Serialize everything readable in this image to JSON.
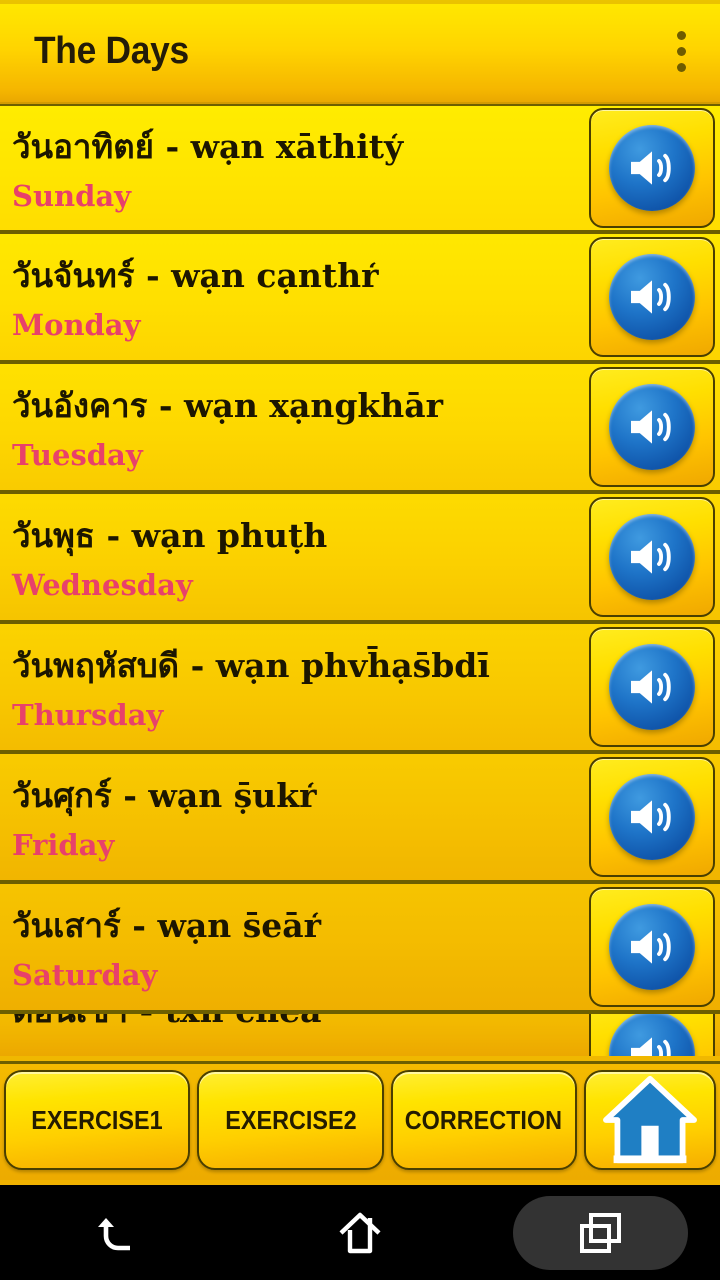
{
  "header": {
    "title": "The Days",
    "overflow_label": "more-options"
  },
  "list": {
    "rows": [
      {
        "native": "วันอาทิตย์ - wạn xāthity̒",
        "english": "Sunday",
        "speaker_label": "play-audio"
      },
      {
        "native": "วันจันทร์ - wạn cạnthr̒",
        "english": "Monday",
        "speaker_label": "play-audio"
      },
      {
        "native": "วันอังคาร - wạn xạngkhār",
        "english": "Tuesday",
        "speaker_label": "play-audio"
      },
      {
        "native": "วันพุธ - wạn phuṭh",
        "english": "Wednesday",
        "speaker_label": "play-audio"
      },
      {
        "native": "วันพฤหัสบดี - wạn phvh̄ạs̄bdī",
        "english": "Thursday",
        "speaker_label": "play-audio"
      },
      {
        "native": "วันศุกร์ - wạn ṣ̄ukr̒",
        "english": "Friday",
        "speaker_label": "play-audio"
      },
      {
        "native": "วันเสาร์ - wạn s̄eār̒",
        "english": "Saturday",
        "speaker_label": "play-audio"
      },
      {
        "native": "ตอนเช้า - txn chêā",
        "english": "",
        "speaker_label": "play-audio"
      }
    ]
  },
  "bottom_bar": {
    "exercise1": "EXERCISE1",
    "exercise2": "EXERCISE2",
    "correction": "CORRECTION",
    "home_label": "home"
  },
  "system_nav": {
    "back_label": "back",
    "home_label": "home",
    "recents_label": "recent-apps"
  },
  "colors": {
    "header_top": "#ffe800",
    "header_bottom": "#eaa800",
    "row_yellow": "#ffe500",
    "row_amber": "#f0b200",
    "divider": "#6d5f00",
    "english_text": "#e8416a",
    "native_text": "#1c1600",
    "speaker_blue": "#1e74c8",
    "nav_bg": "#000000"
  }
}
